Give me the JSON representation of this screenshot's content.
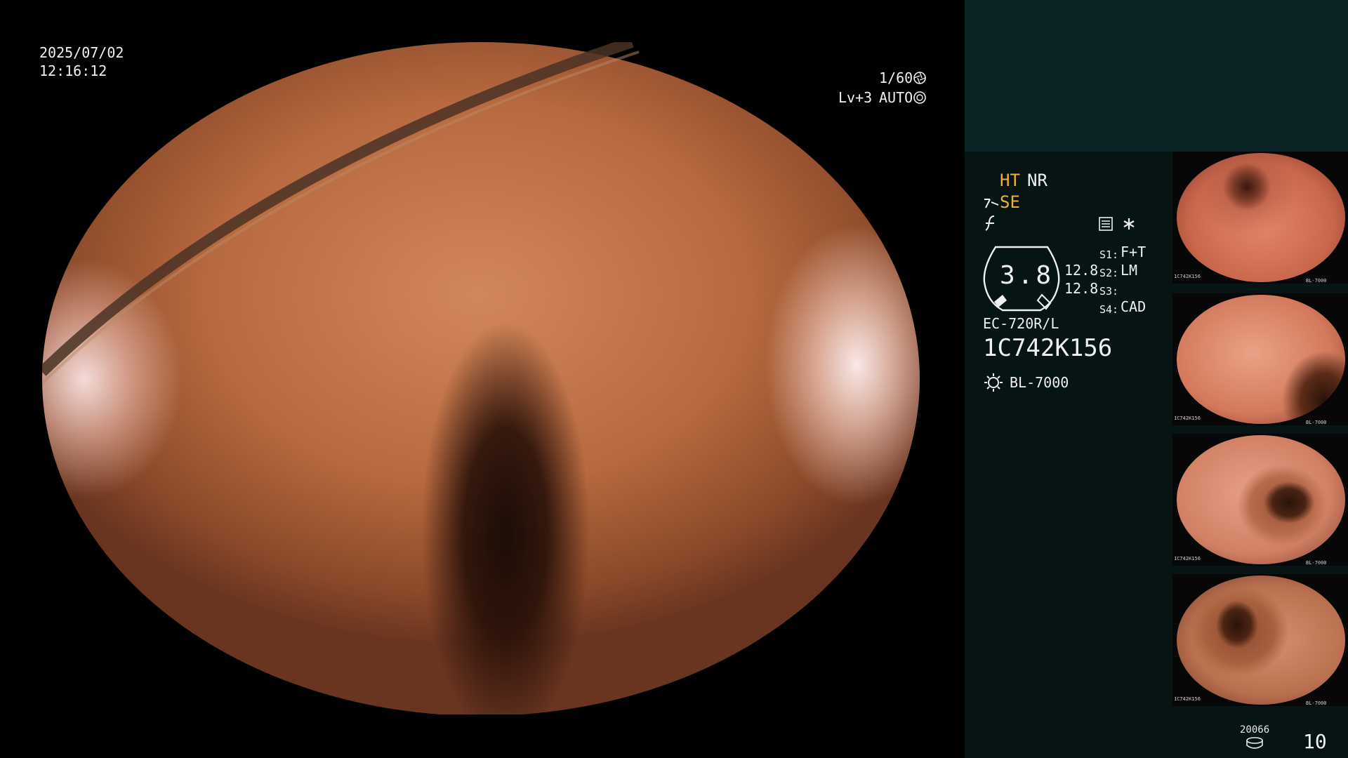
{
  "osd": {
    "date": "2025/07/02",
    "time": "12:16:12",
    "shutter": "1/60",
    "level": "Lv+3",
    "iris_mode": "AUTO"
  },
  "panel": {
    "ht": "HT",
    "nr": "NR",
    "se": "SE",
    "scale_value": "3.8",
    "scale_top": "12.8",
    "scale_bottom": "12.8",
    "s1_label": "S1:",
    "s1_value": "F+T",
    "s2_label": "S2:",
    "s2_value": "LM",
    "s3_label": "S3:",
    "s3_value": "",
    "s4_label": "S4:",
    "s4_value": "CAD",
    "scope_model": "EC-720R/L",
    "scope_serial": "1C742K156",
    "light_source": "BL-7000",
    "record_count": "20066",
    "image_count": "10"
  },
  "thumbnails": [
    {
      "serial": "1C742K156",
      "source": "BL-7000"
    },
    {
      "serial": "1C742K156",
      "source": "BL-7000"
    },
    {
      "serial": "1C742K156",
      "source": "BL-7000"
    },
    {
      "serial": "1C742K156",
      "source": "BL-7000"
    }
  ]
}
